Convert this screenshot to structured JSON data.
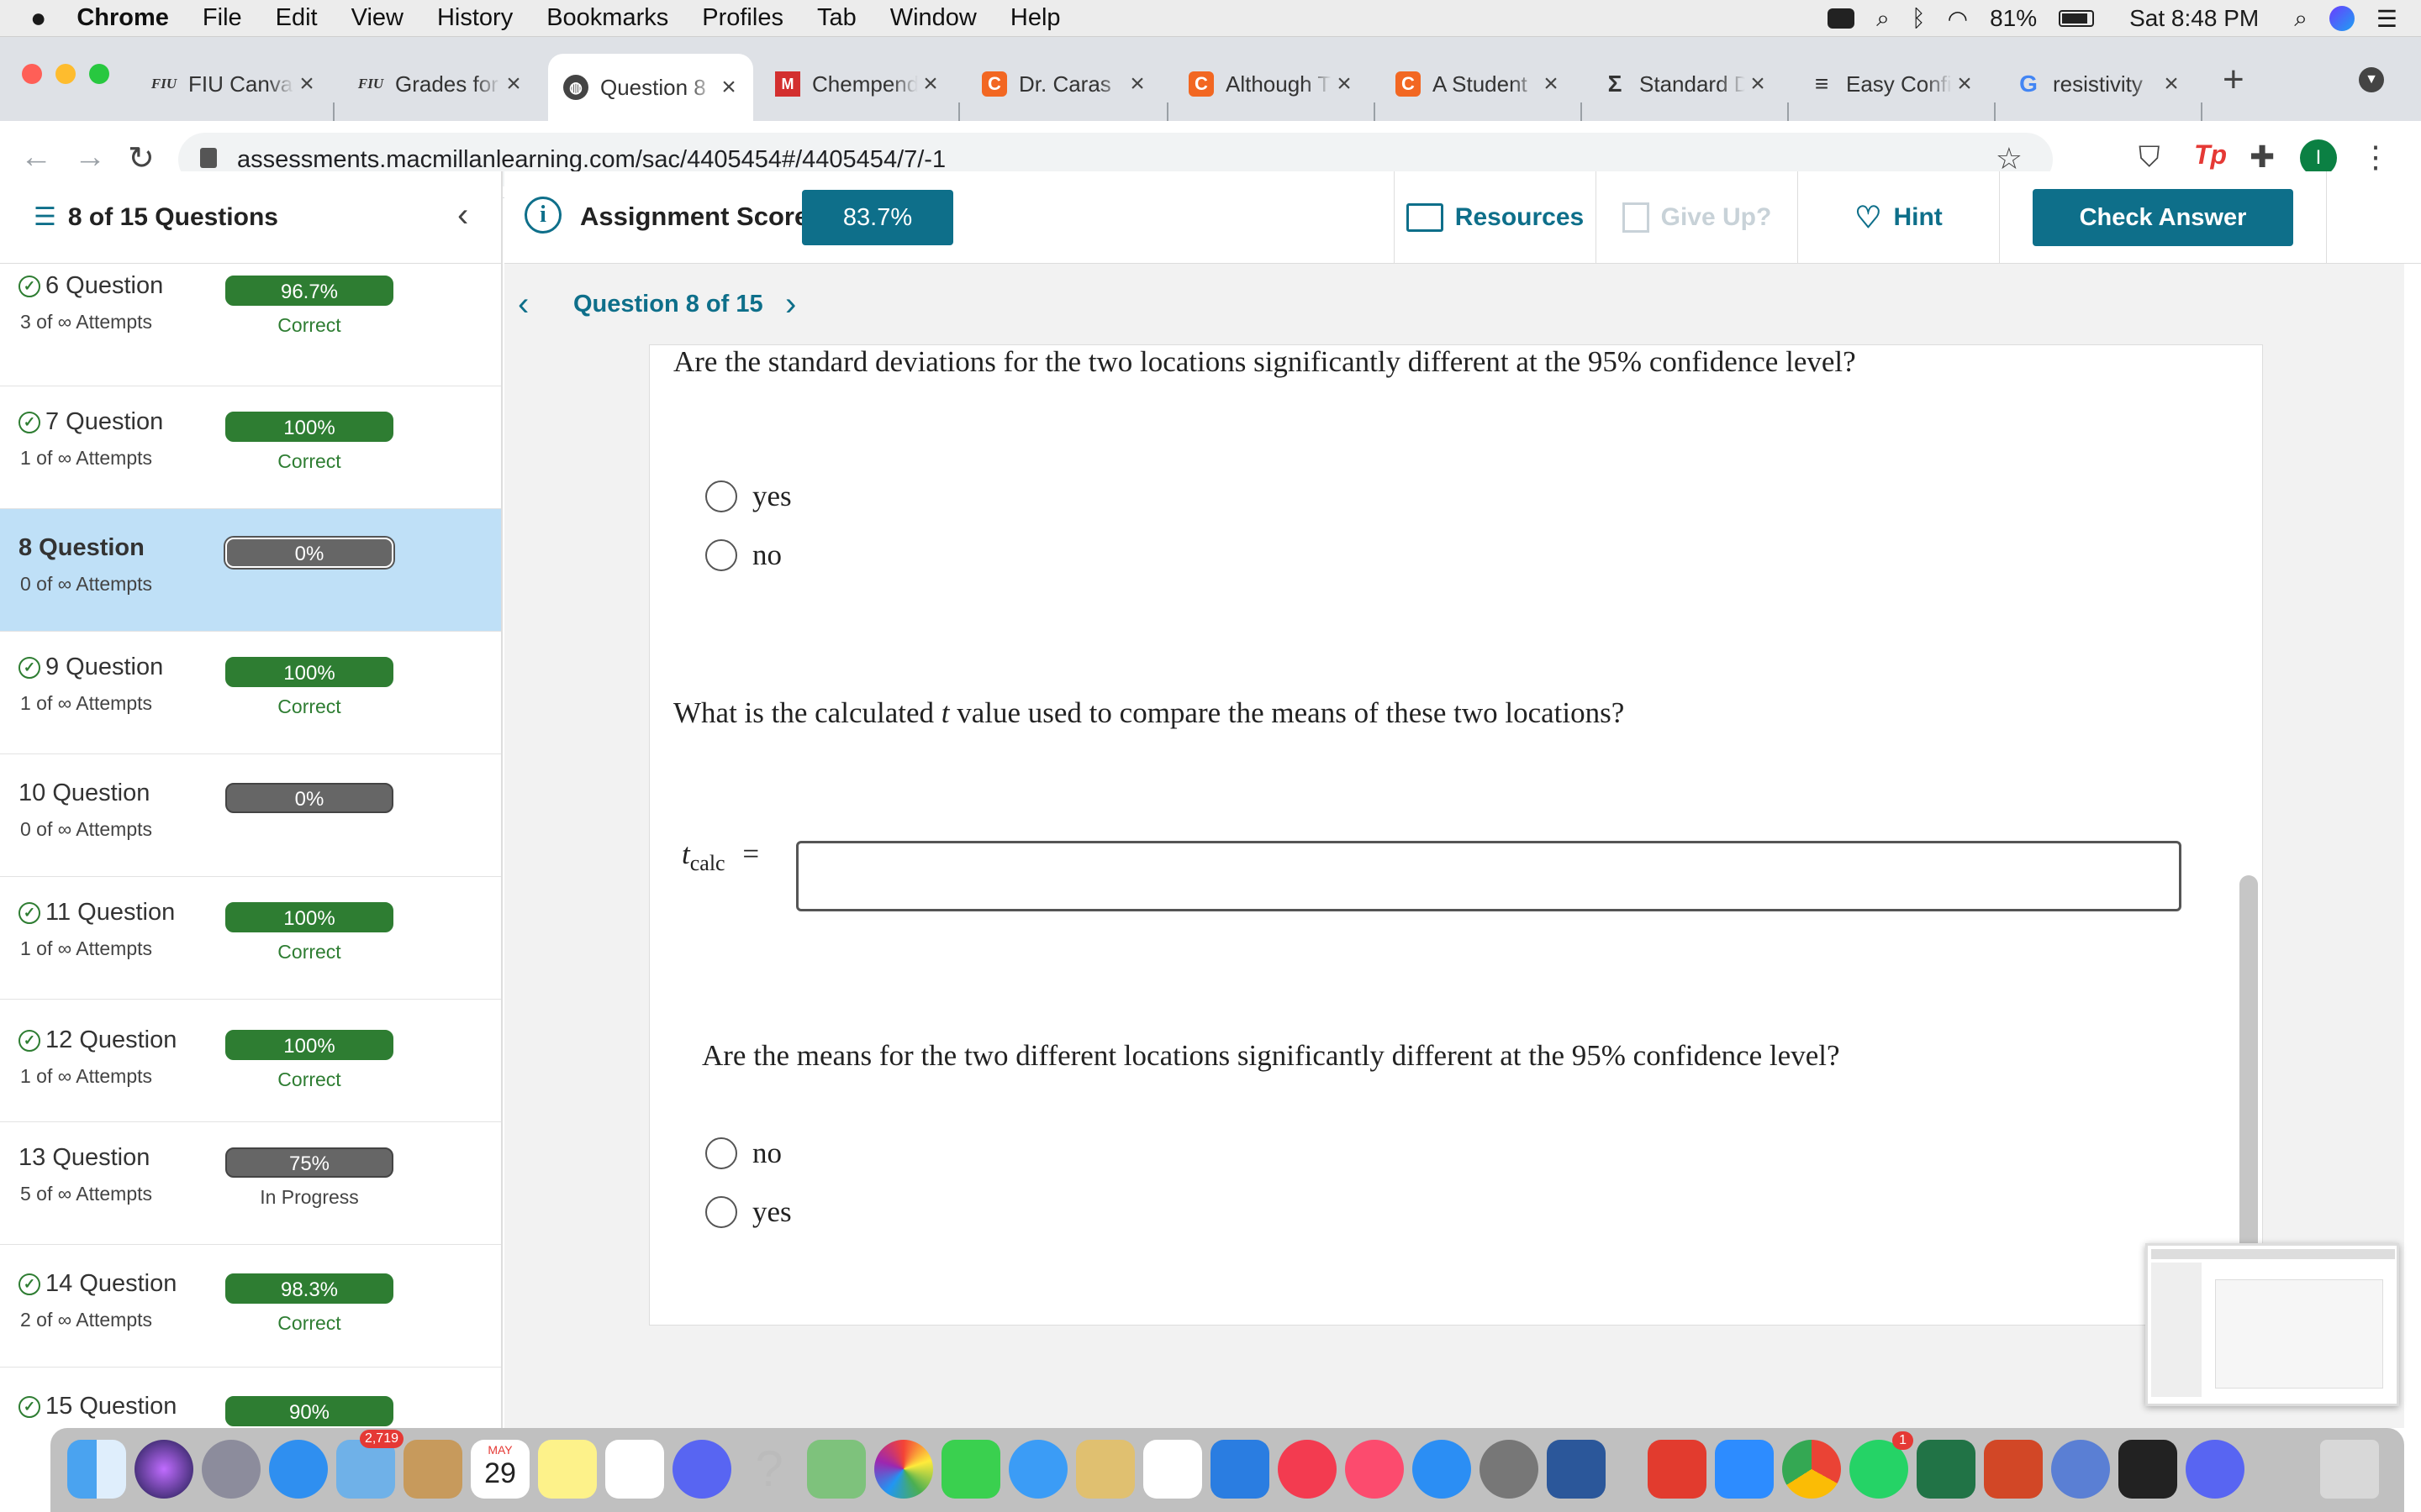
{
  "menubar": {
    "app": "Chrome",
    "items": [
      "File",
      "Edit",
      "View",
      "History",
      "Bookmarks",
      "Profiles",
      "Tab",
      "Window",
      "Help"
    ],
    "battery": "81%",
    "clock": "Sat 8:48 PM"
  },
  "tabs": [
    {
      "icon": "FIU",
      "title": "FIU Canvas"
    },
    {
      "icon": "FIU",
      "title": "Grades for"
    },
    {
      "icon": "globe",
      "title": "Question 8"
    },
    {
      "icon": "M",
      "title": "Chempendix"
    },
    {
      "icon": "C",
      "title": "Dr. Caras"
    },
    {
      "icon": "C",
      "title": "Although T"
    },
    {
      "icon": "C",
      "title": "A Student"
    },
    {
      "icon": "Σ",
      "title": "Standard D"
    },
    {
      "icon": "≡",
      "title": "Easy Confi"
    },
    {
      "icon": "G",
      "title": "resistivity"
    }
  ],
  "address": {
    "url": "assessments.macmillanlearning.com/sac/4405454#/4405454/7/-1",
    "profile_initial": "I"
  },
  "sidebar": {
    "header": "8 of 15 Questions",
    "questions": [
      {
        "title": "6 Question",
        "attempts": "3 of ∞ Attempts",
        "score": "96.7%",
        "status": "Correct",
        "done": true
      },
      {
        "title": "7 Question",
        "attempts": "1 of ∞ Attempts",
        "score": "100%",
        "status": "Correct",
        "done": true
      },
      {
        "title": "8 Question",
        "attempts": "0 of ∞ Attempts",
        "score": "0%",
        "status": "",
        "done": false
      },
      {
        "title": "9 Question",
        "attempts": "1 of ∞ Attempts",
        "score": "100%",
        "status": "Correct",
        "done": true
      },
      {
        "title": "10 Question",
        "attempts": "0 of ∞ Attempts",
        "score": "0%",
        "status": "",
        "done": false
      },
      {
        "title": "11 Question",
        "attempts": "1 of ∞ Attempts",
        "score": "100%",
        "status": "Correct",
        "done": true
      },
      {
        "title": "12 Question",
        "attempts": "1 of ∞ Attempts",
        "score": "100%",
        "status": "Correct",
        "done": true
      },
      {
        "title": "13 Question",
        "attempts": "5 of ∞ Attempts",
        "score": "75%",
        "status": "In Progress",
        "done": false
      },
      {
        "title": "14 Question",
        "attempts": "2 of ∞ Attempts",
        "score": "98.3%",
        "status": "Correct",
        "done": true
      },
      {
        "title": "15 Question",
        "attempts": "",
        "score": "90%",
        "status": "",
        "done": true
      }
    ]
  },
  "header": {
    "score_label": "Assignment Score:",
    "score_value": "83.7%",
    "resources": "Resources",
    "give_up": "Give Up?",
    "hint": "Hint",
    "check_answer": "Check Answer"
  },
  "nav": {
    "label": "Question 8 of 15"
  },
  "question": {
    "q1": "Are the standard deviations for the two locations significantly different at the 95% confidence level?",
    "q1_options": [
      "yes",
      "no"
    ],
    "q2_pre": "What is the calculated ",
    "q2_t": "t",
    "q2_post": " value used to compare the means of these two locations?",
    "tcalc_t": "t",
    "tcalc_sub": "calc",
    "equals": "=",
    "tcalc_value": "",
    "q3": "Are the means for the two different locations significantly different at the 95% confidence level?",
    "q3_options": [
      "no",
      "yes"
    ]
  },
  "dock": {
    "mail_badge": "2,719",
    "calendar_month": "MAY",
    "calendar_day": "29",
    "whatsapp_badge": "1"
  },
  "colors": {
    "accent": "#0e6f8a",
    "correct_green": "#2e7d32",
    "selected_row": "#bfe0f7"
  }
}
